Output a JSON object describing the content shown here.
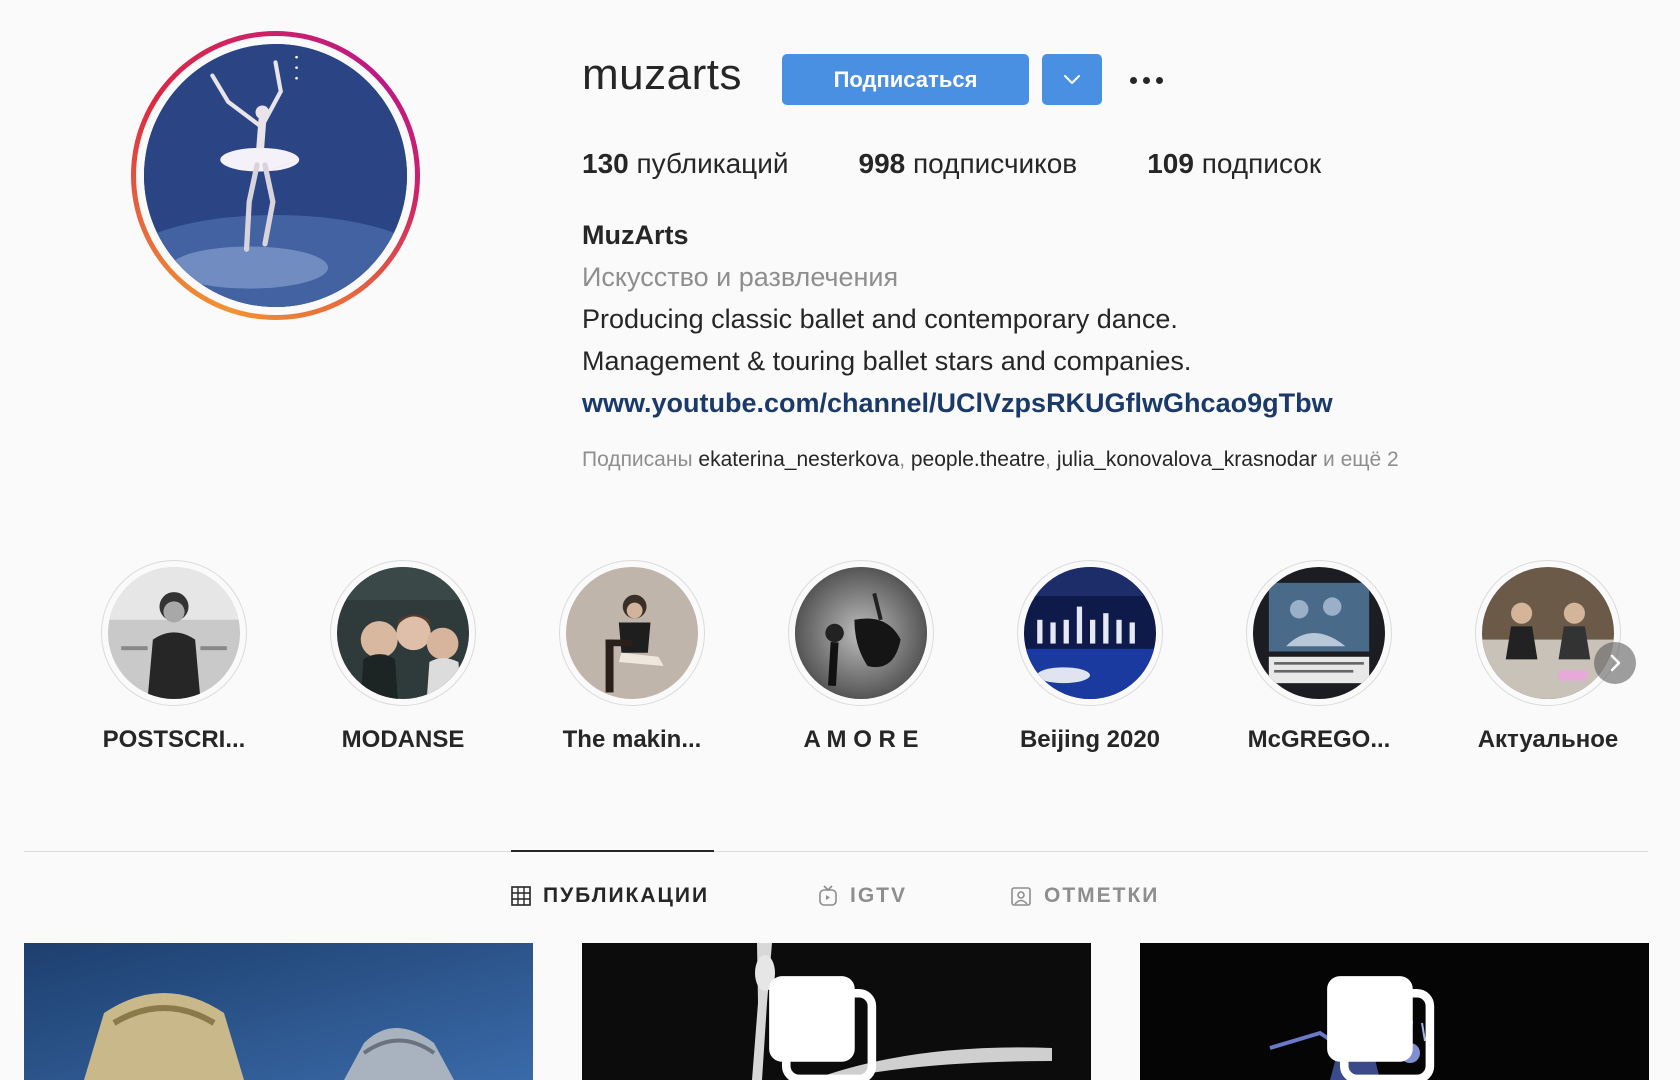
{
  "profile": {
    "username": "muzarts",
    "follow_label": "Подписаться",
    "stats": [
      {
        "count": "130",
        "label": "публикаций"
      },
      {
        "count": "998",
        "label": "подписчиков"
      },
      {
        "count": "109",
        "label": "подписок"
      }
    ],
    "full_name": "MuzArts",
    "category": "Искусство и развлечения",
    "bio_line1": "Producing classic ballet and contemporary dance.",
    "bio_line2": "Management & touring ballet stars and companies.",
    "link": "www.youtube.com/channel/UClVzpsRKUGflwGhcao9gTbw",
    "followed_by": {
      "prefix": "Подписаны",
      "users": [
        "ekaterina_nesterkova",
        "people.theatre",
        "julia_konovalova_krasnodar"
      ],
      "suffix": "и ещё 2"
    }
  },
  "highlights": [
    {
      "label": "POSTSCRI..."
    },
    {
      "label": "MODANSE"
    },
    {
      "label": "The makin..."
    },
    {
      "label": "A M O R E"
    },
    {
      "label": "Beijing 2020"
    },
    {
      "label": "McGREGO..."
    },
    {
      "label": "Актуальное"
    }
  ],
  "tabs": [
    {
      "label": "ПУБЛИКАЦИИ",
      "icon": "grid-icon",
      "active": true
    },
    {
      "label": "IGTV",
      "icon": "igtv-icon",
      "active": false
    },
    {
      "label": "ОТМЕТКИ",
      "icon": "tagged-icon",
      "active": false
    }
  ],
  "colors": {
    "accent": "#4a90e2",
    "text": "#262626",
    "muted": "#8e8e8e",
    "link": "#1a3a6b",
    "background": "#fafafa"
  }
}
